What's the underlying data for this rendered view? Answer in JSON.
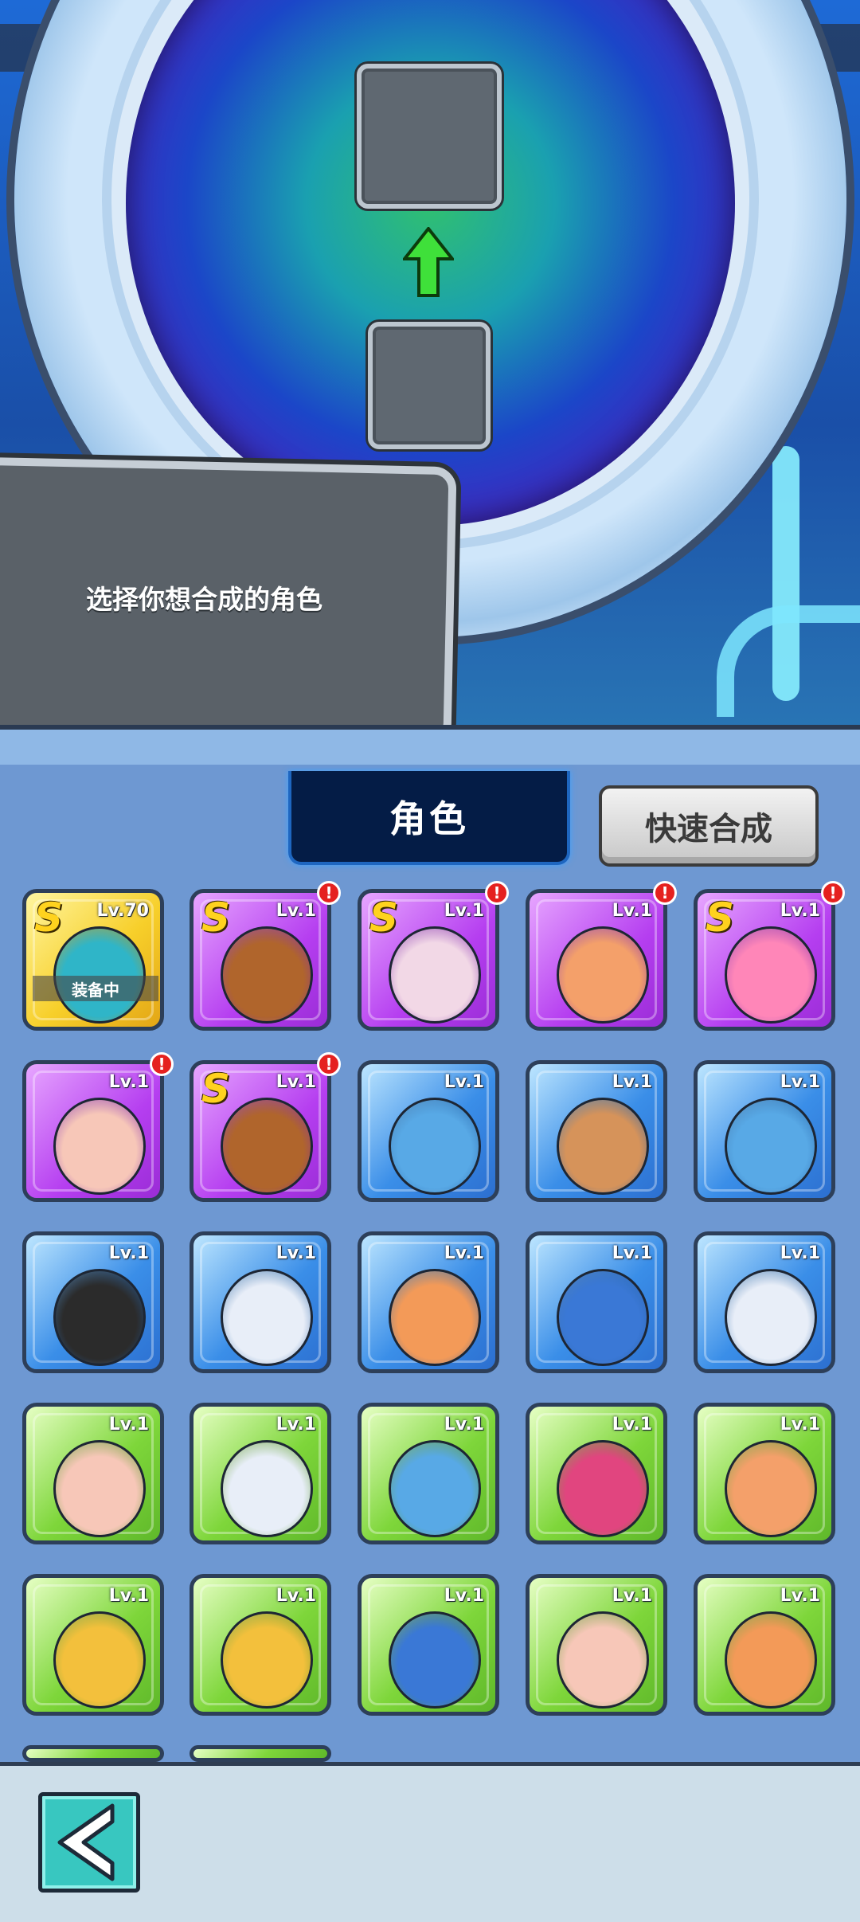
{
  "scene": {
    "prompt_text": "选择你想合成的角色"
  },
  "header": {
    "active_tab_label": "角色",
    "quick_merge_label": "快速合成"
  },
  "characters": [
    {
      "level": "Lv.70",
      "rank": "S",
      "rarity": "gold",
      "alert": false,
      "equipped": true,
      "equipped_label": "装备中",
      "portrait": "teal-hood-hero-icon"
    },
    {
      "level": "Lv.1",
      "rank": "S",
      "rarity": "purple",
      "alert": true,
      "equipped": false,
      "portrait": "brown-lion-icon"
    },
    {
      "level": "Lv.1",
      "rank": "S",
      "rarity": "purple",
      "alert": true,
      "equipped": false,
      "portrait": "white-hair-girl-icon"
    },
    {
      "level": "Lv.1",
      "rank": "",
      "rarity": "purple",
      "alert": true,
      "equipped": false,
      "portrait": "mustache-man-icon"
    },
    {
      "level": "Lv.1",
      "rank": "S",
      "rarity": "purple",
      "alert": true,
      "equipped": false,
      "portrait": "pink-hat-girl-icon"
    },
    {
      "level": "Lv.1",
      "rank": "",
      "rarity": "purple",
      "alert": true,
      "equipped": false,
      "portrait": "chubby-man-icon"
    },
    {
      "level": "Lv.1",
      "rank": "S",
      "rarity": "purple",
      "alert": true,
      "equipped": false,
      "portrait": "brown-lion-icon"
    },
    {
      "level": "Lv.1",
      "rank": "",
      "rarity": "blue",
      "alert": false,
      "equipped": false,
      "portrait": "blue-fish-monster-icon"
    },
    {
      "level": "Lv.1",
      "rank": "",
      "rarity": "blue",
      "alert": false,
      "equipped": false,
      "portrait": "cowboy-icon"
    },
    {
      "level": "Lv.1",
      "rank": "",
      "rarity": "blue",
      "alert": false,
      "equipped": false,
      "portrait": "blue-fish-monster-icon"
    },
    {
      "level": "Lv.1",
      "rank": "",
      "rarity": "blue",
      "alert": false,
      "equipped": false,
      "portrait": "bearded-warrior-icon"
    },
    {
      "level": "Lv.1",
      "rank": "",
      "rarity": "blue",
      "alert": false,
      "equipped": false,
      "portrait": "white-hair-headset-icon"
    },
    {
      "level": "Lv.1",
      "rank": "",
      "rarity": "blue",
      "alert": false,
      "equipped": false,
      "portrait": "bun-hair-girl-icon"
    },
    {
      "level": "Lv.1",
      "rank": "",
      "rarity": "blue",
      "alert": false,
      "equipped": false,
      "portrait": "blue-hood-girl-icon"
    },
    {
      "level": "Lv.1",
      "rank": "",
      "rarity": "blue",
      "alert": false,
      "equipped": false,
      "portrait": "white-hair-headset-icon"
    },
    {
      "level": "Lv.1",
      "rank": "",
      "rarity": "green",
      "alert": false,
      "equipped": false,
      "portrait": "chubby-man-icon"
    },
    {
      "level": "Lv.1",
      "rank": "",
      "rarity": "green",
      "alert": false,
      "equipped": false,
      "portrait": "white-hair-headset-icon"
    },
    {
      "level": "Lv.1",
      "rank": "",
      "rarity": "green",
      "alert": false,
      "equipped": false,
      "portrait": "blue-fish-monster-icon"
    },
    {
      "level": "Lv.1",
      "rank": "",
      "rarity": "green",
      "alert": false,
      "equipped": false,
      "portrait": "pink-hair-goggles-icon"
    },
    {
      "level": "Lv.1",
      "rank": "",
      "rarity": "green",
      "alert": false,
      "equipped": false,
      "portrait": "mustache-man-icon"
    },
    {
      "level": "Lv.1",
      "rank": "",
      "rarity": "green",
      "alert": false,
      "equipped": false,
      "portrait": "blonde-viking-icon"
    },
    {
      "level": "Lv.1",
      "rank": "",
      "rarity": "green",
      "alert": false,
      "equipped": false,
      "portrait": "blonde-viking-icon"
    },
    {
      "level": "Lv.1",
      "rank": "",
      "rarity": "green",
      "alert": false,
      "equipped": false,
      "portrait": "blue-hood-girl-icon"
    },
    {
      "level": "Lv.1",
      "rank": "",
      "rarity": "green",
      "alert": false,
      "equipped": false,
      "portrait": "chubby-man-icon"
    },
    {
      "level": "Lv.1",
      "rank": "",
      "rarity": "green",
      "alert": false,
      "equipped": false,
      "portrait": "bun-hair-girl-icon"
    }
  ],
  "colors": {
    "alert": "#e5211f",
    "tab_active_bg": "#041c46",
    "back_button": "#38c7c0"
  },
  "footer": {
    "back_icon": "back-arrow-icon"
  }
}
